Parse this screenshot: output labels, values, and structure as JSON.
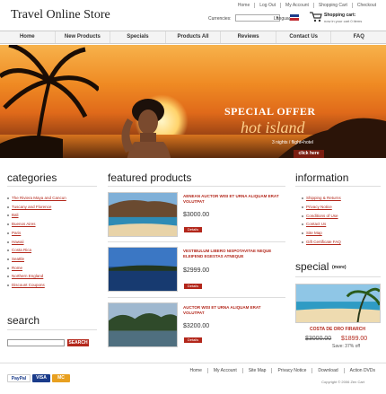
{
  "header": {
    "title": "Travel Online Store",
    "top_links": [
      "Home",
      "Log Out",
      "My Account",
      "Shopping Cart",
      "Checkout"
    ],
    "currencies_label": "Currencies:",
    "currency_value": "",
    "language_label": "Language:",
    "cart_title": "Shopping cart:",
    "cart_subtitle": "now in your cart 0 items"
  },
  "nav": [
    "Home",
    "New Products",
    "Specials",
    "Products All",
    "Reviews",
    "Contact Us",
    "FAQ"
  ],
  "banner": {
    "offer_line1": "SPECIAL OFFER",
    "offer_line2": "hot island",
    "offer_line3": "3 nights / flight+hotel",
    "cta": "click here"
  },
  "categories": {
    "title": "categories",
    "items": [
      "The Riviera Maya and Cancun",
      "Tuscany and Florence",
      "Bali",
      "Buenos Aires",
      "Paris",
      "Hawaii",
      "Costa Rica",
      "Seattle",
      "Rome",
      "Northern England",
      "Discount Coupons"
    ]
  },
  "search": {
    "title": "search",
    "button": "SEARCH"
  },
  "featured": {
    "title": "featured products",
    "products": [
      {
        "name": "AENEAN AUCTOR WISI ET URNA ALIQUAM ERAT VOLUTPAT",
        "price": "$3000.00",
        "details": "Details"
      },
      {
        "name": "VESTIBULUM LIBERO NISPOTAVITAE NEQUE ELEIFEND EGESTAS ATNEQUE",
        "price": "$2999.00",
        "details": "Details"
      },
      {
        "name": "AUCTOR WISI ET URNA ALIQUAM ERAT VOLUTPAT",
        "price": "$3200.00",
        "details": "Details"
      }
    ]
  },
  "information": {
    "title": "information",
    "items": [
      "Shipping & Returns",
      "Privacy Notice",
      "Conditions of Use",
      "Contact Us",
      "Site Map",
      "Gift Certificate FAQ"
    ]
  },
  "special": {
    "title": "special",
    "more": "(more)",
    "product_name": "COSTA DE ORO FIRARCH",
    "old_price": "$3000.00",
    "new_price": "$1899.00",
    "savings": "Save: 37% off"
  },
  "footer": {
    "links": [
      "Home",
      "My Account",
      "Site Map",
      "Privacy Notice",
      "Download",
      "Action DVDs"
    ],
    "copyright": "Copyright © 2006 Zen Cart",
    "payments": [
      "PayPal",
      "VISA",
      "MC"
    ]
  },
  "colors": {
    "accent": "#b3271b",
    "banner": "#e07a1e"
  }
}
